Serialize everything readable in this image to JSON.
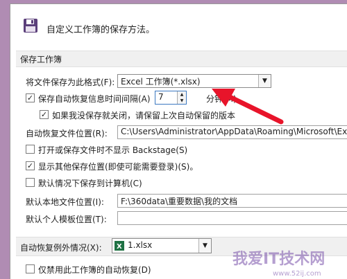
{
  "header": {
    "title": "自定义工作簿的保存方法。",
    "icon": "floppy-disk-icon"
  },
  "section_save": {
    "title": "保存工作簿"
  },
  "save_format": {
    "label": "将文件保存为此格式(F):",
    "value": "Excel 工作簿(*.xlsx)"
  },
  "autorecover_interval": {
    "label": "保存自动恢复信息时间间隔(A)",
    "value": "7",
    "unit": "分钟(M)",
    "checked": true
  },
  "keep_last": {
    "label": "如果我没保存就关闭，请保留上次自动保留的版本",
    "checked": true
  },
  "autorecover_location": {
    "label": "自动恢复文件位置(R):",
    "value": "C:\\Users\\Administrator\\AppData\\Roaming\\Microsoft\\Exc"
  },
  "no_backstage": {
    "label": "打开或保存文件时不显示 Backstage(S)",
    "checked": false
  },
  "show_other": {
    "label": "显示其他保存位置(即使可能需要登录)(S)。",
    "checked": true
  },
  "default_local": {
    "label": "默认情况下保存到计算机(C)",
    "checked": false
  },
  "default_location": {
    "label": "默认本地文件位置(I):",
    "value": "F:\\360data\\重要数据\\我的文档"
  },
  "template_location": {
    "label": "默认个人模板位置(T):",
    "value": ""
  },
  "section_exceptions": {
    "label": "自动恢复例外情况(X):",
    "value": "1.xlsx"
  },
  "disable_autorecover": {
    "label": "仅禁用此工作簿的自动恢复(D)",
    "checked": false
  },
  "watermark": {
    "text": "我爱IT技术网",
    "url": "www.52ij.com"
  },
  "colors": {
    "accent": "#3b78c0",
    "arrow": "#e8142a",
    "excel_green": "#1f7244"
  }
}
